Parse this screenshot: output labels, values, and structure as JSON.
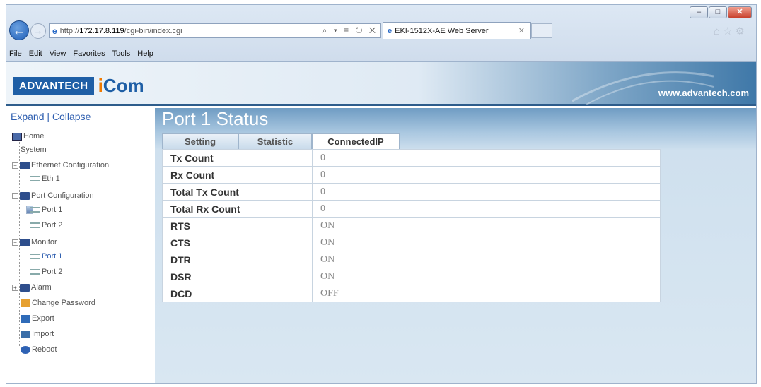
{
  "browser": {
    "url_prefix": "http://",
    "url_host": "172.17.8.119",
    "url_path": "/cgi-bin/index.cgi",
    "addr_tools": "⌕ ▾ ≡ ↻ ✕",
    "tab_title": "EKI-1512X-AE Web Server",
    "menu": [
      "File",
      "Edit",
      "View",
      "Favorites",
      "Tools",
      "Help"
    ]
  },
  "banner": {
    "logo_text": "ADVANTECH",
    "logo_icom_i": "i",
    "logo_icom_rest": "Com",
    "site": "www.advantech.com"
  },
  "sidebar": {
    "expand": "Expand",
    "separator": "|",
    "collapse": "Collapse",
    "items": [
      {
        "label": "Home"
      },
      {
        "label": "System"
      },
      {
        "label": "Ethernet Configuration"
      },
      {
        "label": "Eth 1"
      },
      {
        "label": "Port Configuration"
      },
      {
        "label": "Port 1"
      },
      {
        "label": "Port 2"
      },
      {
        "label": "Monitor"
      },
      {
        "label": "Port 1"
      },
      {
        "label": "Port 2"
      },
      {
        "label": "Alarm"
      },
      {
        "label": "Change Password"
      },
      {
        "label": "Export"
      },
      {
        "label": "Import"
      },
      {
        "label": "Reboot"
      }
    ]
  },
  "content": {
    "title": "Port 1 Status",
    "tabs": [
      {
        "label": "Setting"
      },
      {
        "label": "Statistic"
      },
      {
        "label": "ConnectedIP"
      }
    ],
    "rows": [
      {
        "label": "Tx Count",
        "value": "0"
      },
      {
        "label": "Rx Count",
        "value": "0"
      },
      {
        "label": "Total Tx Count",
        "value": "0"
      },
      {
        "label": "Total Rx Count",
        "value": "0"
      },
      {
        "label": "RTS",
        "value": "ON"
      },
      {
        "label": "CTS",
        "value": "ON"
      },
      {
        "label": "DTR",
        "value": "ON"
      },
      {
        "label": "DSR",
        "value": "ON"
      },
      {
        "label": "DCD",
        "value": "OFF"
      }
    ]
  }
}
